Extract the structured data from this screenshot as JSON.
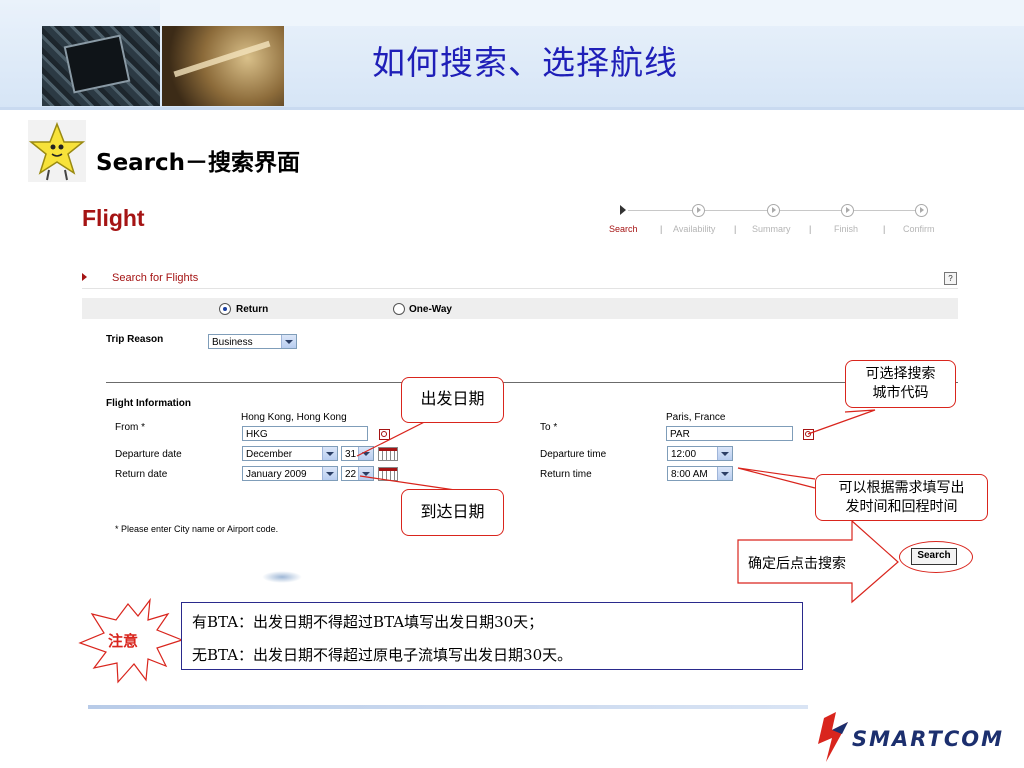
{
  "header": {
    "title": "如何搜索、选择航线"
  },
  "section": {
    "heading": "Search－搜索界面"
  },
  "flight": {
    "title": "Flight",
    "steps": [
      "Search",
      "Availability",
      "Summary",
      "Finish",
      "Confirm"
    ],
    "step_separator": "|",
    "search_for_flights": "Search for Flights",
    "help": "?",
    "trip_type": {
      "return_label": "Return",
      "oneway_label": "One-Way",
      "selected": "Return"
    },
    "trip_reason": {
      "label": "Trip Reason",
      "value": "Business"
    },
    "flight_info_label": "Flight Information",
    "from": {
      "label": "From *",
      "city": "Hong Kong, Hong Kong",
      "code": "HKG"
    },
    "to": {
      "label": "To *",
      "city": "Paris, France",
      "code": "PAR"
    },
    "departure_date": {
      "label": "Departure date",
      "month": "December",
      "day": "31"
    },
    "return_date": {
      "label": "Return date",
      "month": "January 2009",
      "day": "22"
    },
    "departure_time": {
      "label": "Departure time",
      "value": "12:00"
    },
    "return_time": {
      "label": "Return time",
      "value": "8:00 AM"
    },
    "footnote": "* Please enter City name or Airport code.",
    "search_button": "Search"
  },
  "callouts": {
    "departure_date": "出发日期",
    "return_date": "到达日期",
    "city_code": [
      "可选择搜索",
      "城市代码"
    ],
    "time": [
      "可以根据需求填写出",
      "发时间和回程时间"
    ],
    "confirm_search": "确定后点击搜索"
  },
  "notice": {
    "badge": "注意",
    "lines": [
      "有BTA：出发日期不得超过BTA填写出发日期30天；",
      "无BTA：出发日期不得超过原电子流填写出发日期30天。"
    ]
  },
  "logo": {
    "text": "SMARTCOM"
  },
  "colors": {
    "title_blue": "#1f1fb8",
    "flight_red": "#a51414",
    "callout_red": "#d9251d",
    "notice_border": "#2a2a8c"
  }
}
